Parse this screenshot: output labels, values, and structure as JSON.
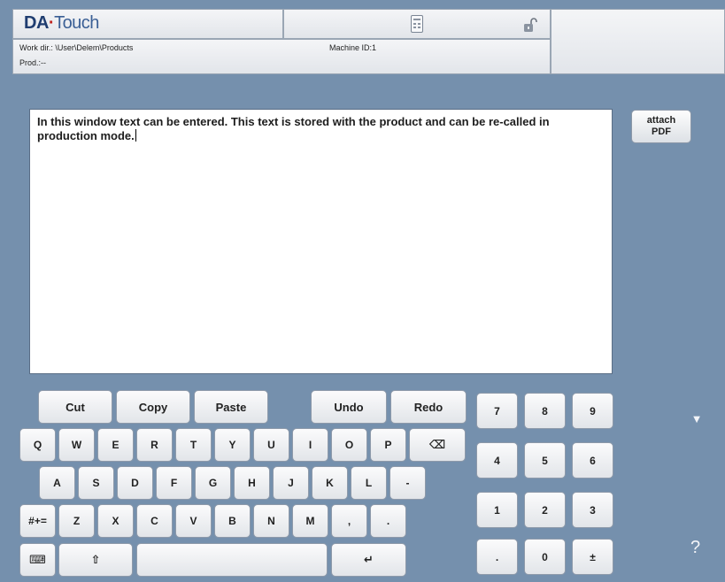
{
  "header": {
    "logo_brand": "DA",
    "logo_dot": "·",
    "logo_product": "Touch",
    "work_dir": "Work dir.: \\User\\Delem\\Products",
    "machine_id": "Machine ID:1",
    "prod": "Prod.:--",
    "icons": [
      "calculator-icon",
      "lock-open-icon"
    ]
  },
  "editor": {
    "text": "In this window text can be entered. This text is stored with the product and can be re-called in production mode."
  },
  "side": {
    "attach_line1": "attach",
    "attach_line2": "PDF",
    "scroll_down_glyph": "▼",
    "help": "?"
  },
  "keyboard": {
    "edit_row": [
      "Cut",
      "Copy",
      "Paste",
      "Undo",
      "Redo"
    ],
    "row1": [
      "Q",
      "W",
      "E",
      "R",
      "T",
      "Y",
      "U",
      "I",
      "O",
      "P"
    ],
    "backspace_glyph": "⌫",
    "row2": [
      "A",
      "S",
      "D",
      "F",
      "G",
      "H",
      "J",
      "K",
      "L",
      "-"
    ],
    "row3_mode": "#+=",
    "row3": [
      "Z",
      "X",
      "C",
      "V",
      "B",
      "N",
      "M",
      ",",
      "."
    ],
    "keyboard_icon_glyph": "⌨",
    "shift_glyph": "⇧",
    "space": "",
    "enter_glyph": "↵"
  },
  "numpad": {
    "row1": [
      "7",
      "8",
      "9"
    ],
    "row2": [
      "4",
      "5",
      "6"
    ],
    "row3": [
      "1",
      "2",
      "3"
    ],
    "row4": [
      ".",
      "0",
      "±"
    ]
  },
  "colors": {
    "background": "#7590ad",
    "logo_blue": "#1f3d70",
    "logo_red": "#c0241f"
  }
}
